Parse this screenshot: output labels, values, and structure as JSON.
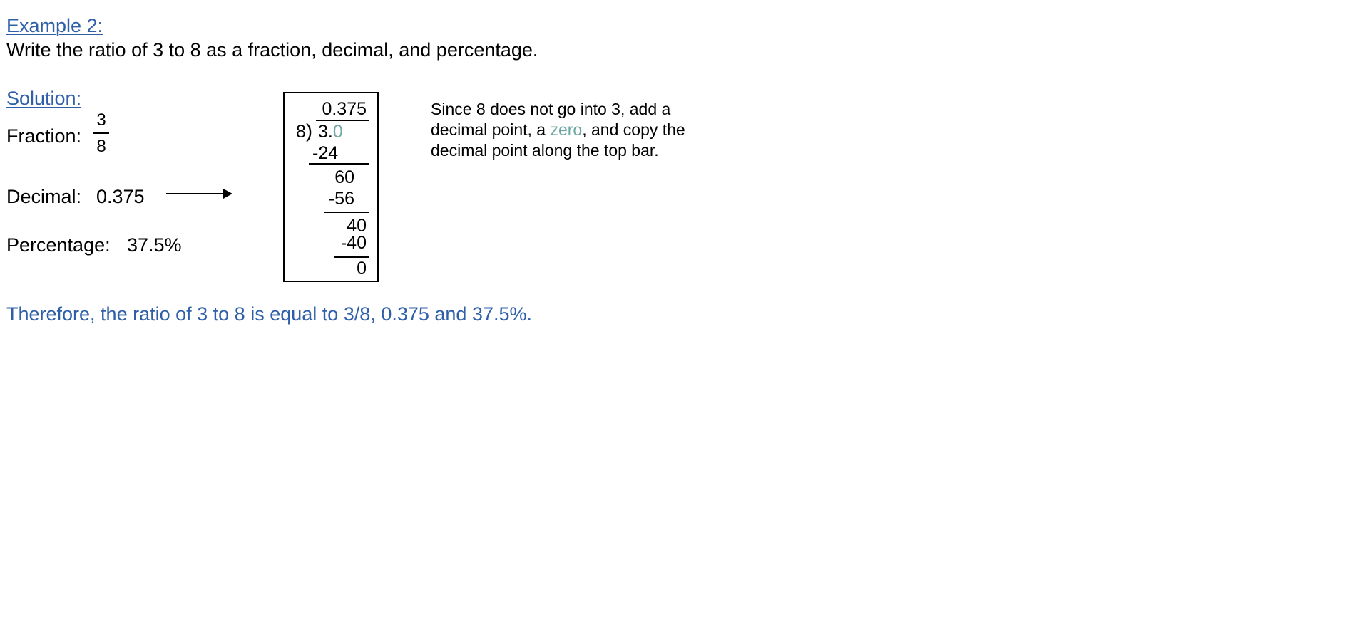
{
  "heading": "Example 2:",
  "question": "Write the ratio of 3 to 8 as a fraction, decimal, and percentage.",
  "solution_heading": "Solution:",
  "fraction": {
    "label": "Fraction:",
    "numerator": "3",
    "denominator": "8"
  },
  "decimal": {
    "label": "Decimal:",
    "value": "0.375"
  },
  "percentage": {
    "label": "Percentage:",
    "value": "37.5%"
  },
  "long_division": {
    "quotient": "0.375",
    "divisor": "8",
    "paren": ")",
    "dividend_main": "3.",
    "dividend_added": "0",
    "steps": [
      "-24",
      "60",
      "-56",
      "40",
      "-40",
      "0"
    ]
  },
  "explanation": {
    "line1": "Since 8 does not go into 3, add a",
    "line2_before": "decimal point, a ",
    "line2_highlight": "zero",
    "line2_after": ", and copy the",
    "line3": "decimal point along the top bar."
  },
  "conclusion": "Therefore, the ratio of 3 to 8 is equal to 3/8, 0.375 and 37.5%.",
  "colors": {
    "heading": "#2e5fa8",
    "highlight": "#6fa8a3",
    "text": "#000000"
  }
}
